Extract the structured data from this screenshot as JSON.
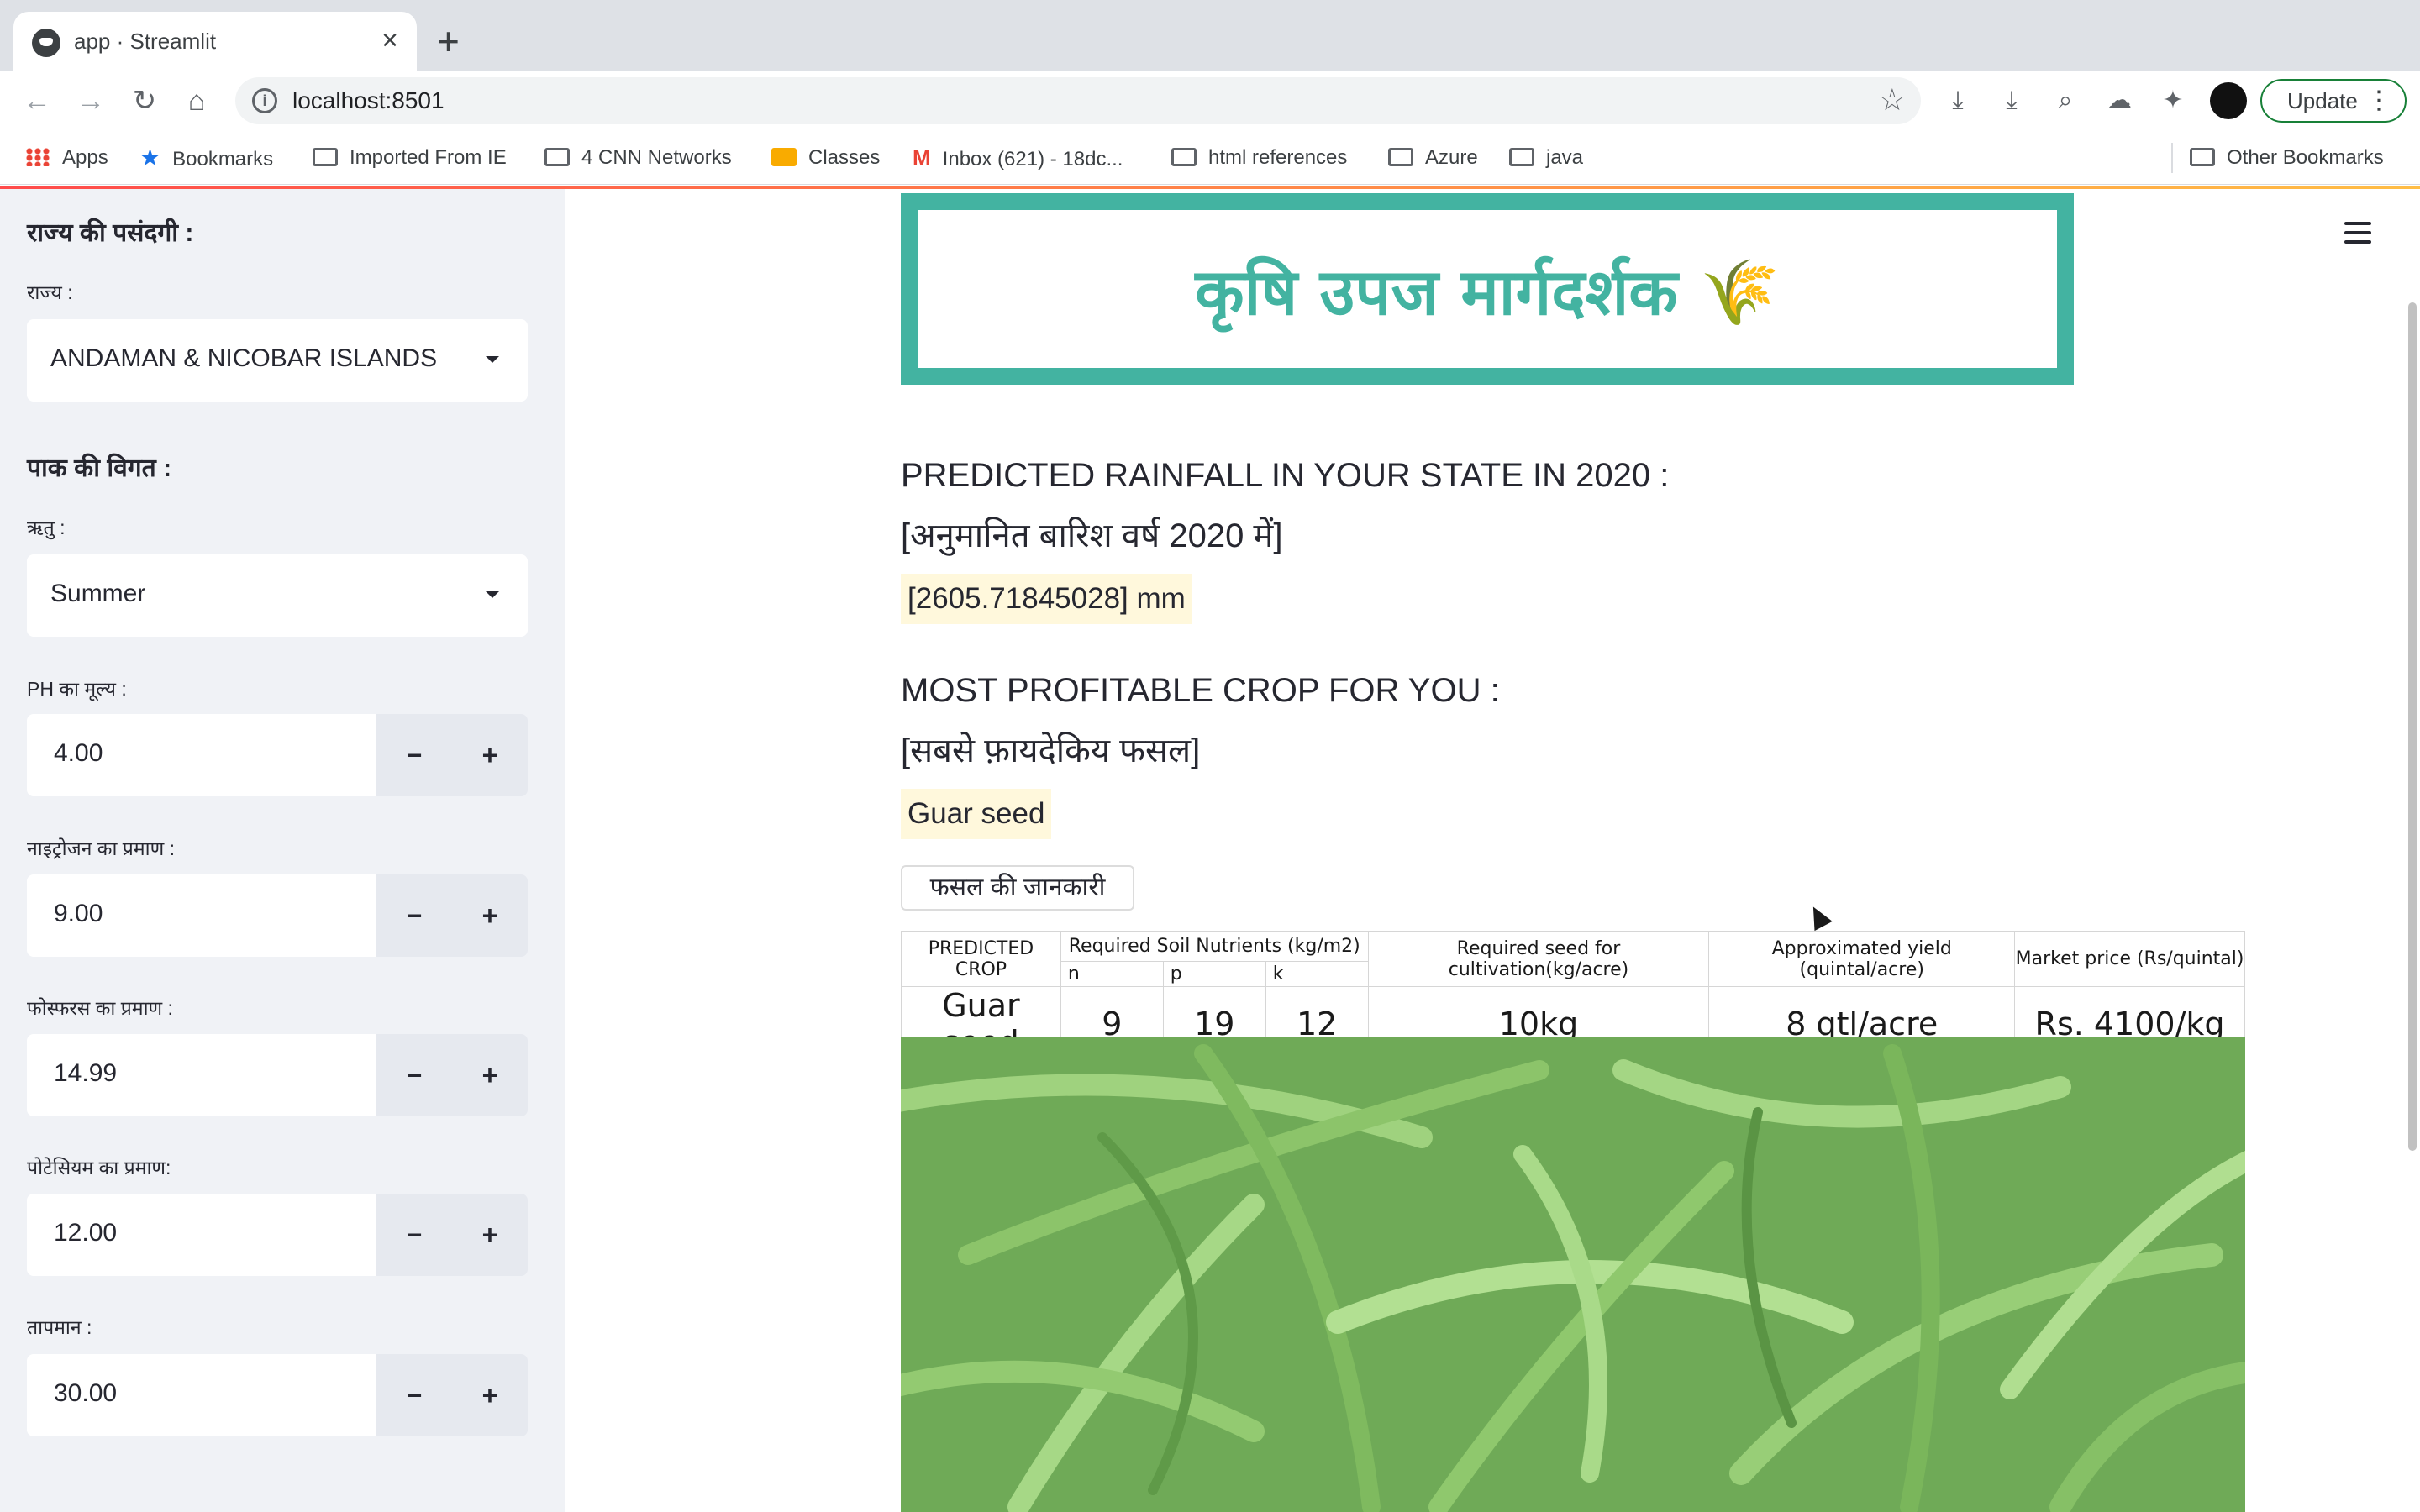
{
  "browser": {
    "tab_title": "app · Streamlit",
    "url": "localhost:8501",
    "update_label": "Update",
    "bookmarks": [
      "Apps",
      "Bookmarks",
      "Imported From IE",
      "4 CNN Networks",
      "Classes",
      "Inbox (621) - 18dc...",
      "html references",
      "Azure",
      "java"
    ],
    "other_bookmarks": "Other Bookmarks"
  },
  "sidebar": {
    "state_heading": "राज्य की पसंदगी :",
    "state_label": "राज्य :",
    "state_value": "ANDAMAN & NICOBAR ISLANDS",
    "crop_heading": "पाक की विगत :",
    "season_label": "ऋतु :",
    "season_value": "Summer",
    "ph_label": "PH का मूल्य :",
    "ph_value": "4.00",
    "nitrogen_label": "नाइट्रोजन का प्रमाण :",
    "nitrogen_value": "9.00",
    "phosphorus_label": "फोस्फरस का प्रमाण :",
    "phosphorus_value": "14.99",
    "potassium_label": "पोटेसियम का प्रमाण:",
    "potassium_value": "12.00",
    "temperature_label": "तापमान :",
    "temperature_value": "30.00",
    "minus": "−",
    "plus": "+"
  },
  "main": {
    "banner_title": "कृषि उपज मार्गदर्शक",
    "banner_emoji": "🌾",
    "rainfall_heading": "PREDICTED RAINFALL IN YOUR STATE IN 2020 :",
    "rainfall_heading_hindi": "[अनुमानित बारिश वर्ष 2020 में]",
    "rainfall_value": "[2605.71845028] mm",
    "crop_heading": "MOST PROFITABLE CROP FOR YOU :",
    "crop_heading_hindi": "[सबसे फ़ायदेकिय फसल]",
    "crop_value": "Guar seed",
    "info_button": "फसल की जानकारी",
    "table": {
      "col_crop": "PREDICTED CROP",
      "col_nutrients": "Required Soil Nutrients (kg/m2)",
      "sub_n": "n",
      "sub_p": "p",
      "sub_k": "k",
      "col_seed": "Required seed for cultivation(kg/acre)",
      "col_yield": "Approximated yield (quintal/acre)",
      "col_price": "Market price (Rs/quintal)",
      "crop": "Guar seed",
      "n": "9",
      "p": "19",
      "k": "12",
      "seed": "10kg",
      "yield": "8 qtl/acre",
      "price": "Rs. 4100/kg"
    }
  },
  "colors": {
    "accent": "#43b3a1",
    "sidebar_bg": "#f0f2f6",
    "result_bg": "#fff8dc"
  }
}
